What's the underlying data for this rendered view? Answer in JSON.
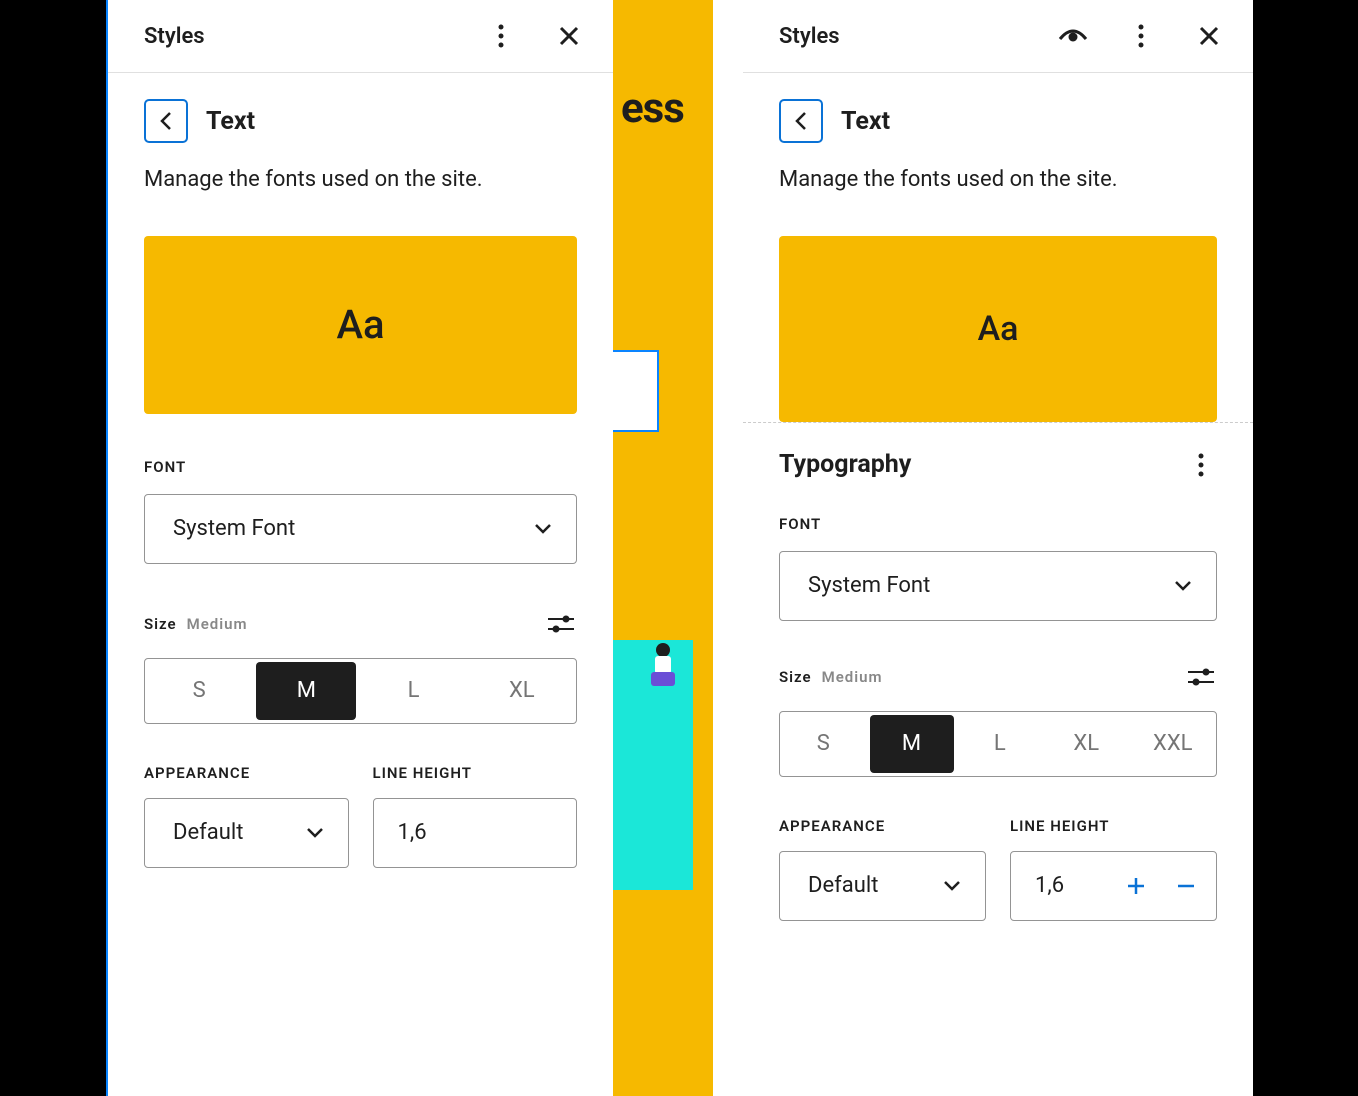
{
  "left": {
    "header_title": "Styles",
    "crumb_title": "Text",
    "description": "Manage the fonts used on the site.",
    "preview_glyph": "Aa",
    "font_label": "Font",
    "font_value": "System Font",
    "size_label": "Size",
    "size_value": "Medium",
    "size_options": [
      "S",
      "M",
      "L",
      "XL"
    ],
    "size_active_index": 1,
    "appearance_label": "Appearance",
    "appearance_value": "Default",
    "lineheight_label": "Line Height",
    "lineheight_value": "1,6"
  },
  "right": {
    "header_title": "Styles",
    "crumb_title": "Text",
    "description": "Manage the fonts used on the site.",
    "preview_glyph": "Aa",
    "typography_heading": "Typography",
    "font_label": "Font",
    "font_value": "System Font",
    "size_label": "Size",
    "size_value": "Medium",
    "size_options": [
      "S",
      "M",
      "L",
      "XL",
      "XXL"
    ],
    "size_active_index": 1,
    "appearance_label": "Appearance",
    "appearance_value": "Default",
    "lineheight_label": "Line Height",
    "lineheight_value": "1,6"
  },
  "mid": {
    "partial_text": "ess"
  },
  "colors": {
    "accent": "#f6b900",
    "primary": "#0a72d6",
    "dark": "#1e1e1e"
  }
}
